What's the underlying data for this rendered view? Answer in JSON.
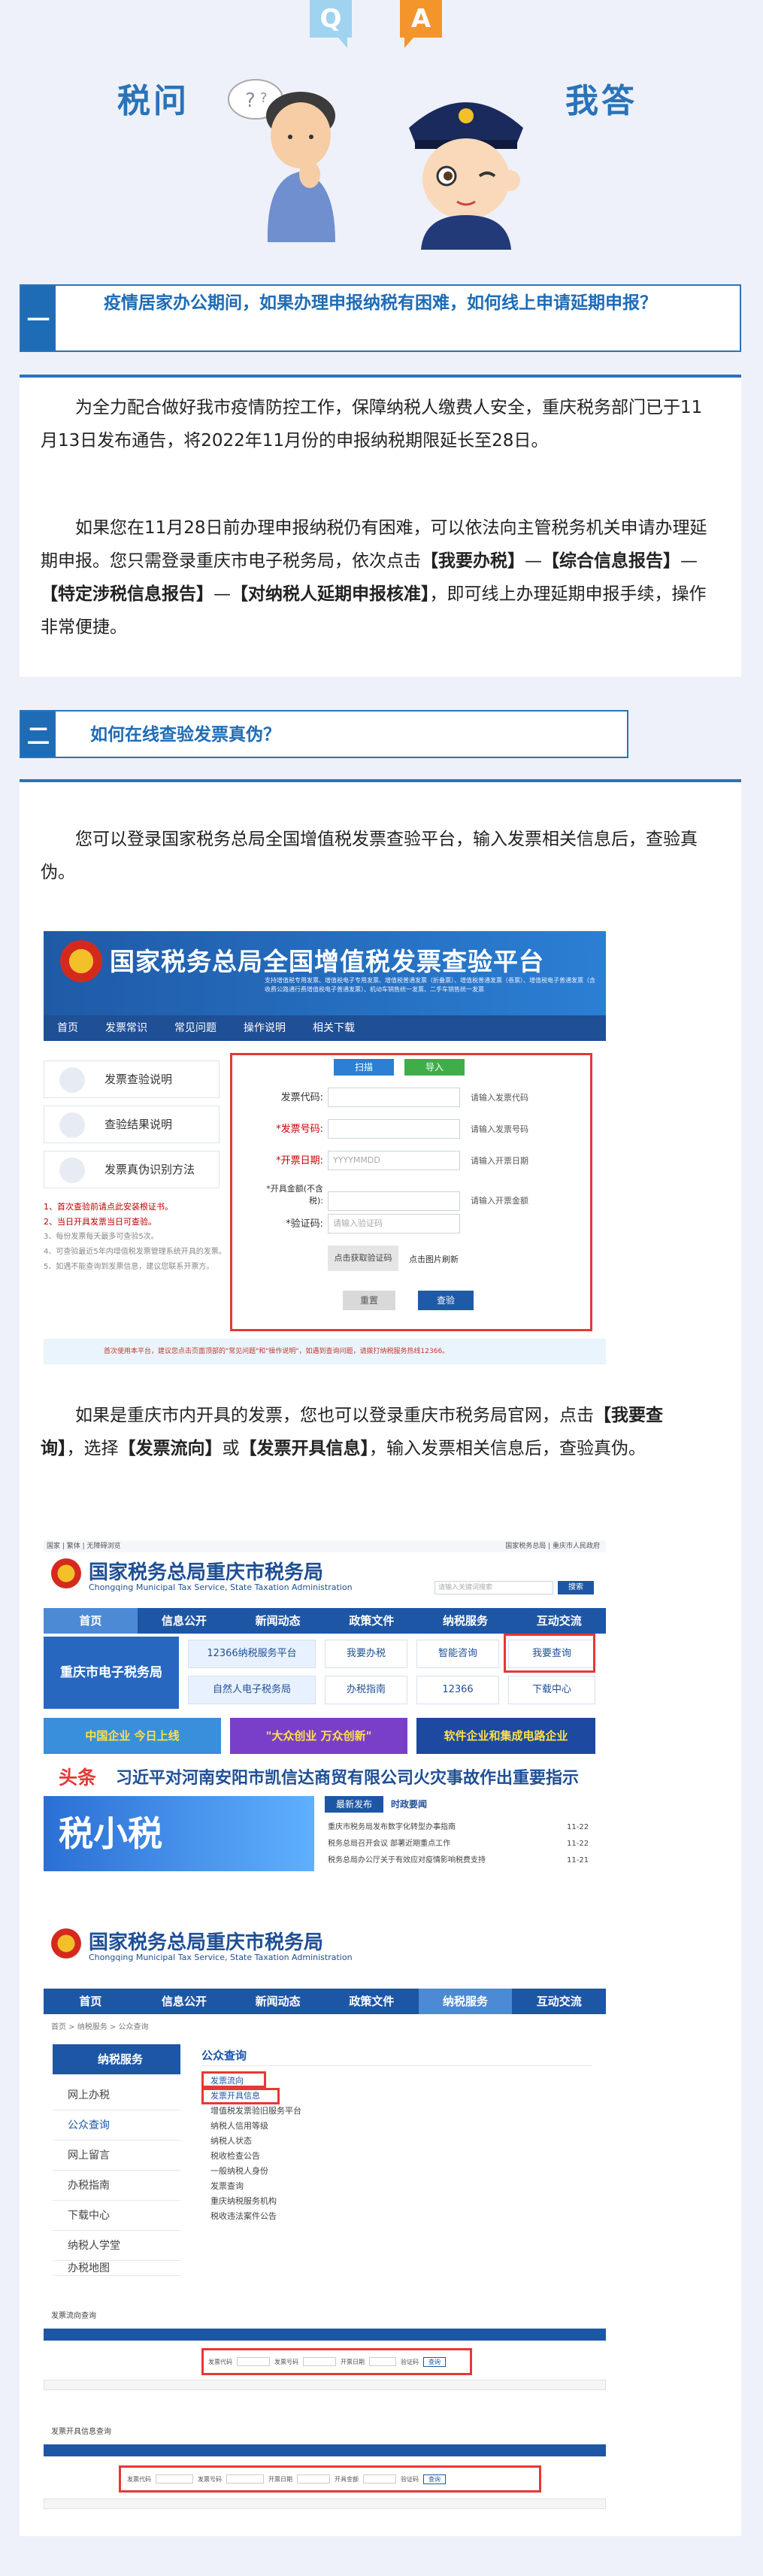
{
  "header": {
    "q_badge": "Q",
    "a_badge": "A",
    "left_title": "税问",
    "right_title": "我答"
  },
  "sections": [
    {
      "num": "一",
      "question": "疫情居家办公期间，如果办理申报纳税有困难，如何线上申请延期申报？",
      "paragraphs": [
        "为全力配合做好我市疫情防控工作，保障纳税人缴费人安全，重庆税务部门已于11月13日发布通告，将2022年11月份的申报纳税期限延长至28日。",
        "如果您在11月28日前办理申报纳税仍有困难，可以依法向主管税务机关申请办理延期申报。您只需登录重庆市电子税务局，依次点击"
      ],
      "path_parts": [
        "【我要办税】",
        "—",
        "【综合信息报告】",
        "—",
        "【特定涉税信息报告】",
        "—",
        "【对纳税人延期申报核准】"
      ],
      "path_tail": "，即可线上办理延期申报手续，操作非常便捷。"
    },
    {
      "num": "二",
      "question": "如何在线查验发票真伪？",
      "paragraphs": [
        "您可以登录国家税务总局全国增值税发票查验平台，输入发票相关信息后，查验真伪。"
      ],
      "para2_a": "如果是重庆市内开具的发票，您也可以登录重庆市税务局官网，点击",
      "para2_b": "【我要查询】",
      "para2_c": "，选择",
      "para2_d": "【发票流向】",
      "para2_e": "或",
      "para2_f": "【发票开具信息】",
      "para2_g": "，输入发票相关信息后，查验真伪。"
    }
  ],
  "shot1": {
    "brand": "国家税务总局全国增值税发票查验平台",
    "brand_note": "支持增值税专用发票、增值税电子专用发票、增值税普通发票（折叠票）、增值税普通发票（卷票）、增值税电子普通发票（含收费公路通行费增值税电子普通发票）、机动车销售统一发票、二手车销售统一发票",
    "nav": [
      "首页",
      "发票常识",
      "常见问题",
      "操作说明",
      "相关下载"
    ],
    "side": [
      "发票查验说明",
      "查验结果说明",
      "发票真伪识别方法"
    ],
    "tab_single": "扫描",
    "tab_import": "导入",
    "fields": [
      {
        "label": "发票代码:",
        "placeholder": "",
        "hint": "请输入发票代码"
      },
      {
        "label": "*发票号码:",
        "placeholder": "",
        "hint": "请输入发票号码"
      },
      {
        "label": "*开票日期:",
        "placeholder": "YYYYMMDD",
        "hint": "请输入开票日期"
      },
      {
        "label": "*开具金额(不含税):",
        "placeholder": "",
        "hint": "请输入开票金额"
      },
      {
        "label": "*验证码:",
        "placeholder": "请输入验证码",
        "hint": ""
      }
    ],
    "captcha_text": "点击获取验证码",
    "captcha_hint": "点击图片刷新",
    "btn_reset": "重置",
    "btn_check": "查验",
    "red_notes": [
      "1、首次查验前请点此安装根证书。",
      "2、当日开具发票当日可查验。"
    ],
    "grey_notes": [
      "3、每份发票每天最多可查验5次。",
      "4、可查验最近5年内增值税发票管理系统开具的发票。",
      "5、如遇不能查询到发票信息，建议您联系开票方。"
    ],
    "bottom_notice": "首次使用本平台，建议您点击页面顶部的\"常见问题\"和\"操作说明\"，如遇到查询问题，请拨打纳税服务热线12366。"
  },
  "shot2": {
    "top_left": "国家 | 繁体 | 无障碍浏览",
    "top_right": "国家税务总局 | 重庆市人民政府",
    "title": "国家税务总局重庆市税务局",
    "subtitle": "Chongqing Municipal Tax Service, State Taxation Administration",
    "search_placeholder": "请输入关键词搜索",
    "search_btn": "搜索",
    "nav": [
      "首页",
      "信息公开",
      "新闻动态",
      "政策文件",
      "纳税服务",
      "互动交流"
    ],
    "hero": "重庆市电子税务局",
    "tiles": [
      "12366纳税服务平台",
      "自然人电子税务局",
      "我要办税",
      "办税指南",
      "智能咨询",
      "12366",
      "我要查询",
      "下载中心"
    ],
    "banners": [
      "中国企业 今日上线",
      "\"大众创业 万众创新\"",
      "软件企业和集成电路企业"
    ],
    "topic_tag": "头条",
    "topic": "习近平对河南安阳市凯信达商贸有限公司火灾事故作出重要指示",
    "news_tab1": "最新发布",
    "news_tab2": "时政要闻",
    "news": [
      "重庆市税务局发布数字化转型办事指南",
      "税务总局召开会议 部署近期重点工作",
      "税务总局办公厅关于有效应对疫情影响税费支持"
    ],
    "news_dates": [
      "11-22",
      "11-22",
      "11-21"
    ],
    "slogan": "税小税"
  },
  "shot3": {
    "nav": [
      "首页",
      "信息公开",
      "新闻动态",
      "政策文件",
      "纳税服务",
      "互动交流"
    ],
    "breadcrumb": "首页 > 纳税服务 > 公众查询",
    "side_title": "纳税服务",
    "side": [
      "网上办税",
      "公众查询",
      "网上留言",
      "办税指南",
      "下载中心",
      "纳税人学堂",
      "办税地图"
    ],
    "panel_title": "公众查询",
    "items": [
      "发票流向",
      "发票开具信息",
      "增值税发票验旧服务平台",
      "纳税人信用等级",
      "纳税人状态",
      "税收检查公告",
      "一般纳税人身份",
      "发票查询",
      "重庆纳税服务机构",
      "税收违法案件公告"
    ]
  },
  "shot4": {
    "title": "发票流向查询",
    "fields": [
      "发票代码",
      "发票号码",
      "开票日期",
      "验证码",
      "查询"
    ]
  },
  "shot5": {
    "title": "发票开具信息查询",
    "fields": [
      "发票代码",
      "发票号码",
      "开票日期",
      "开具金额",
      "验证码",
      "查询"
    ]
  }
}
